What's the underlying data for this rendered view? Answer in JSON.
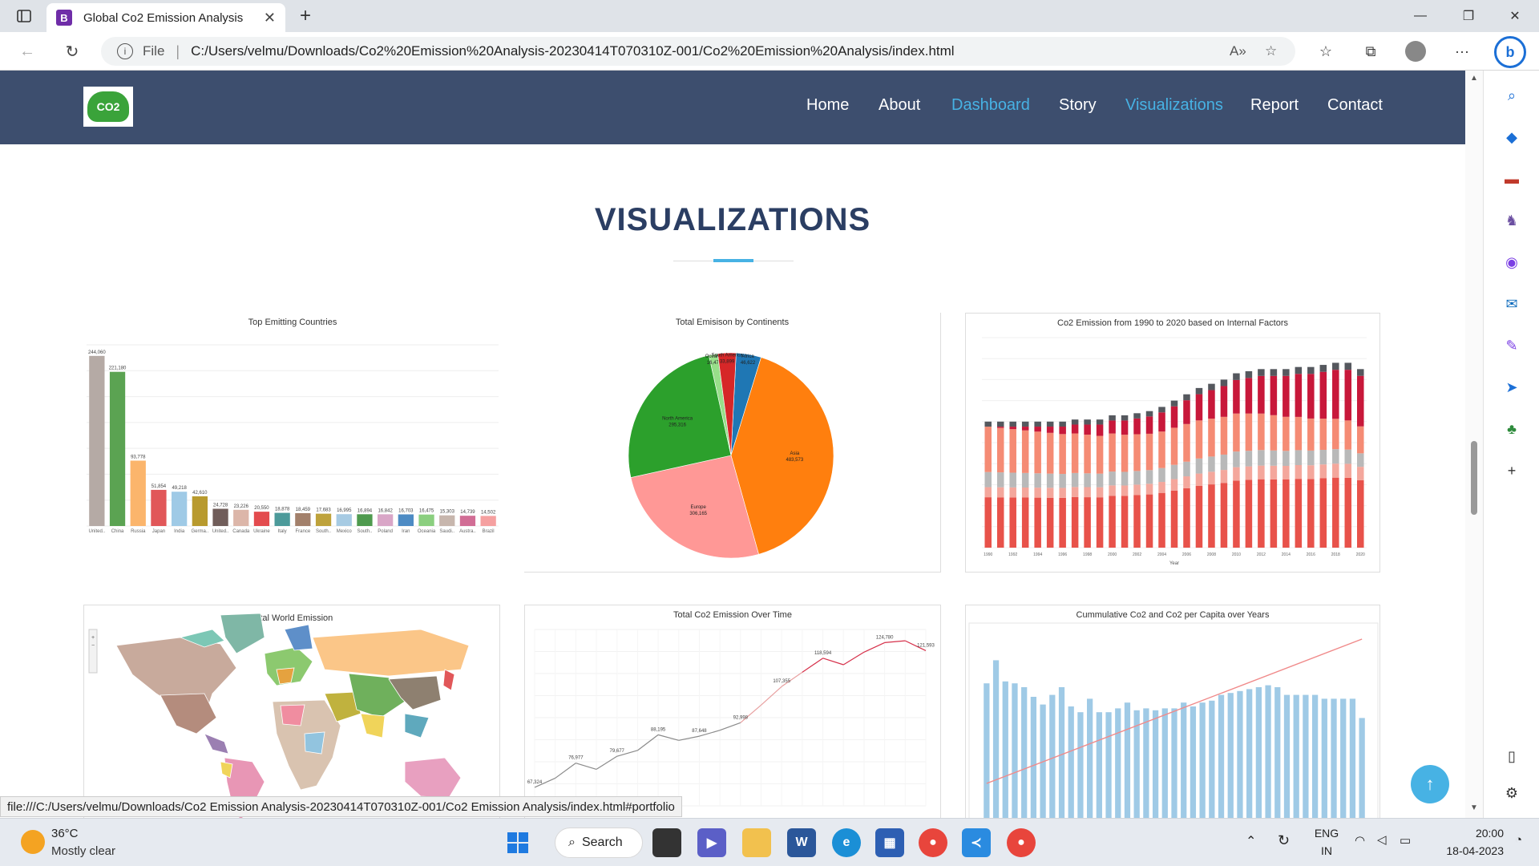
{
  "browser": {
    "tab_title": "Global Co2 Emission Analysis",
    "tab_favicon": "B",
    "address_label": "File",
    "url": "C:/Users/velmu/Downloads/Co2%20Emission%20Analysis-20230414T070310Z-001/Co2%20Emission%20Analysis/index.html",
    "status_url": "file:///C:/Users/velmu/Downloads/Co2 Emission Analysis-20230414T070310Z-001/Co2 Emission Analysis/index.html#portfolio"
  },
  "site": {
    "logo_text": "CO2",
    "nav": [
      {
        "label": "Home",
        "active": false
      },
      {
        "label": "About",
        "active": false
      },
      {
        "label": "Dashboard",
        "active": true
      },
      {
        "label": "Story",
        "active": false
      },
      {
        "label": "Visualizations",
        "active": true
      },
      {
        "label": "Report",
        "active": false
      },
      {
        "label": "Contact",
        "active": false
      }
    ],
    "section_title": "VISUALIZATIONS"
  },
  "charts": {
    "top_countries_title": "Top Emitting Countries",
    "continents_title": "Total Emisison by Continents",
    "internal_factors_title": "Co2 Emission  from 1990 to 2020 based on Internal Factors",
    "world_title": "Total World Emission",
    "over_time_title": "Total Co2  Emission Over Time",
    "cumulative_title": "Cummulative Co2 and Co2 per Capita over Years",
    "internal_xlabel": "Year"
  },
  "chart_data": [
    {
      "type": "bar",
      "title": "Top Emitting Countries",
      "categories": [
        "United..",
        "China",
        "Russia",
        "Japan",
        "India",
        "Germa..",
        "United..",
        "Canada",
        "Ukraine",
        "Italy",
        "France",
        "South..",
        "Mexico",
        "South..",
        "Poland",
        "Iran",
        "Oceania",
        "Saudi..",
        "Austra..",
        "Brazil"
      ],
      "values": [
        244060,
        221180,
        93778,
        51854,
        49218,
        42610,
        24728,
        23226,
        20550,
        18878,
        18459,
        17683,
        16995,
        16894,
        16842,
        16703,
        16475,
        15303,
        14739,
        14502
      ],
      "labels": [
        "244,060",
        "221,180",
        "93,778",
        "51,854",
        "49,218",
        "42,610",
        "24,728",
        "23,226",
        "20,550",
        "18,878",
        "18,459",
        "17,683",
        "16,995",
        "16,894",
        "16,842",
        "16,703",
        "16,475",
        "15,303",
        "14,739",
        "14,502"
      ],
      "colors": [
        "#b5aaa5",
        "#5ba352",
        "#fbb56c",
        "#e15759",
        "#9fcae6",
        "#b89a2e",
        "#705d5a",
        "#dcb6a9",
        "#e34b4e",
        "#4c9a9a",
        "#a2806b",
        "#bea23b",
        "#a7cbe3",
        "#4e9a4e",
        "#d9a6c7",
        "#4d8bc4",
        "#8bcf7f",
        "#c7b6ad",
        "#d16d95",
        "#f5a0a0"
      ],
      "ylim": [
        0,
        260000
      ]
    },
    {
      "type": "pie",
      "title": "Total Emisison by Continents",
      "slices": [
        {
          "name": "Asia",
          "value": 483573,
          "label": "483,573",
          "color": "#ff7f0e"
        },
        {
          "name": "Europe",
          "value": 306165,
          "label": "306,165",
          "color": "#ff9896"
        },
        {
          "name": "North America",
          "value": 295316,
          "label": "295,316",
          "color": "#2ca02c"
        },
        {
          "name": "Oceania",
          "value": 16475,
          "label": "16,475",
          "color": "#98df8a"
        },
        {
          "name": "South America",
          "value": 33899,
          "label": "33,899",
          "color": "#d62728"
        },
        {
          "name": "Africa",
          "value": 46622,
          "label": "46,622",
          "color": "#1f77b4"
        }
      ]
    },
    {
      "type": "bar",
      "title": "Co2 Emission  from 1990 to 2020 based on Internal Factors",
      "xlabel": "Year",
      "x": [
        1990,
        1991,
        1992,
        1993,
        1994,
        1995,
        1996,
        1997,
        1998,
        1999,
        2000,
        2001,
        2002,
        2003,
        2004,
        2005,
        2006,
        2007,
        2008,
        2009,
        2010,
        2011,
        2012,
        2013,
        2014,
        2015,
        2016,
        2017,
        2018,
        2019,
        2020
      ],
      "tick_labels": [
        "1990",
        "1992",
        "1994",
        "1996",
        "1998",
        "2000",
        "2002",
        "2004",
        "2006",
        "2008",
        "2010",
        "2012",
        "2014",
        "2016",
        "2018",
        "2020"
      ],
      "stacked": true,
      "series_colors": [
        "#e8524a",
        "#f4a79c",
        "#b9b9b9",
        "#f58b74",
        "#c8183a",
        "#55585e"
      ],
      "totals": [
        0.6,
        0.6,
        0.6,
        0.6,
        0.6,
        0.6,
        0.6,
        0.61,
        0.61,
        0.61,
        0.63,
        0.63,
        0.64,
        0.65,
        0.67,
        0.7,
        0.73,
        0.76,
        0.78,
        0.8,
        0.83,
        0.84,
        0.85,
        0.85,
        0.85,
        0.86,
        0.86,
        0.87,
        0.88,
        0.88,
        0.85
      ]
    },
    {
      "type": "line",
      "title": "Total Co2  Emission Over Time",
      "point_labels": [
        "67,324",
        "76,977",
        "79,677",
        "88,195",
        "87,648",
        "92,998",
        "107,355",
        "118,594",
        "124,780",
        "121,593"
      ],
      "values": [
        67324,
        71000,
        76977,
        74500,
        79677,
        82000,
        88195,
        86000,
        87648,
        90000,
        92998,
        100000,
        107355,
        113000,
        118594,
        116000,
        121000,
        124780,
        125500,
        121593
      ]
    },
    {
      "type": "bar",
      "title": "Cummulative Co2 and Co2 per Capita over Years",
      "bar_color": "#9fcae6",
      "line_color": "#f08a8a",
      "bars": [
        0.72,
        0.84,
        0.73,
        0.72,
        0.7,
        0.65,
        0.61,
        0.66,
        0.7,
        0.6,
        0.57,
        0.64,
        0.57,
        0.57,
        0.59,
        0.62,
        0.58,
        0.59,
        0.58,
        0.59,
        0.59,
        0.62,
        0.6,
        0.62,
        0.63,
        0.66,
        0.67,
        0.68,
        0.69,
        0.7,
        0.71,
        0.7,
        0.66,
        0.66,
        0.66,
        0.66,
        0.64,
        0.64,
        0.64,
        0.64,
        0.54
      ],
      "line": [
        0.2,
        0.95
      ]
    }
  ],
  "taskbar": {
    "temperature": "36°C",
    "weather": "Mostly clear",
    "search_label": "Search",
    "lang_top": "ENG",
    "lang_bottom": "IN",
    "time": "20:00",
    "date": "18-04-2023"
  }
}
